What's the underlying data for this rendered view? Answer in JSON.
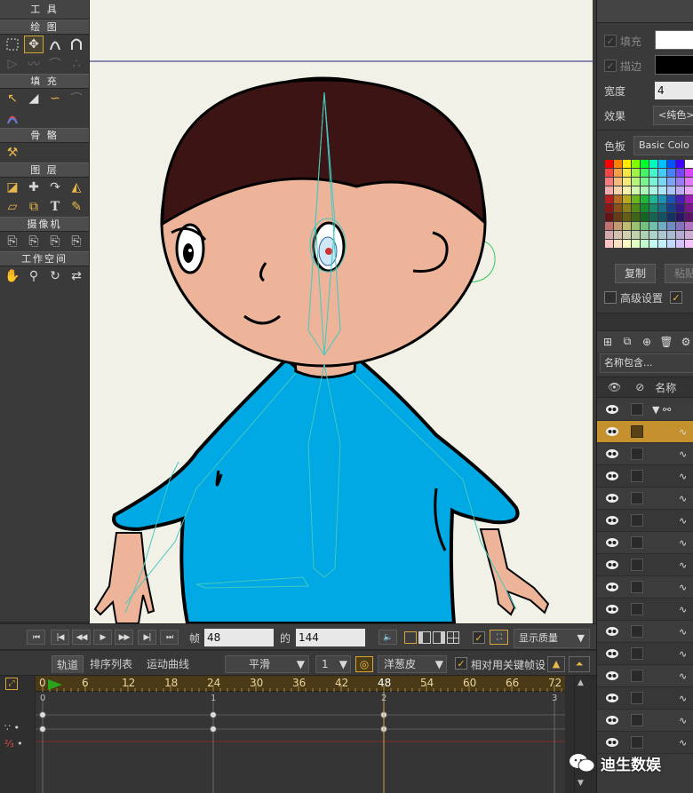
{
  "tools_panel": {
    "title": "工 具",
    "sections": {
      "draw": "绘 图",
      "fill": "填 充",
      "bone": "骨 骼",
      "layer": "图 层",
      "camera": "摄像机",
      "workspace": "工作空间"
    }
  },
  "style_panel": {
    "fill_label": "填充",
    "stroke_label": "描边",
    "fill_color": "#ffffff",
    "stroke_color": "#000000",
    "width_label": "宽度",
    "width_value": "4",
    "effect_label": "效果",
    "effect_value": "<纯色>",
    "swatches_label": "色板",
    "swatches_value": "Basic Colo",
    "copy_button": "复制",
    "paste_button": "粘贴",
    "advanced_label": "高级设置"
  },
  "layers_panel": {
    "search_value": "名称包含...",
    "name_header": "名称",
    "rows": [
      {
        "selected": false,
        "group": true
      },
      {
        "selected": true
      },
      {
        "selected": false
      },
      {
        "selected": false
      },
      {
        "selected": false
      },
      {
        "selected": false
      },
      {
        "selected": false
      },
      {
        "selected": false
      },
      {
        "selected": false
      },
      {
        "selected": false
      },
      {
        "selected": false
      },
      {
        "selected": false
      },
      {
        "selected": false
      },
      {
        "selected": false
      },
      {
        "selected": false
      },
      {
        "selected": false
      }
    ]
  },
  "playback": {
    "frame_label": "帧",
    "frame_value": "48",
    "of_label": "的",
    "total_value": "144",
    "quality_value": "显示质量"
  },
  "timeline": {
    "tab_track": "轨道",
    "tab_sequence": "排序列表",
    "tab_motion": "运动曲线",
    "interp_value": "平滑",
    "interval_value": "1",
    "onion_label": "洋葱皮",
    "relative_keys_label": "相对用关键帧设",
    "ruler_ticks": [
      "0",
      "6",
      "12",
      "18",
      "24",
      "30",
      "36",
      "42",
      "48",
      "54",
      "60",
      "66",
      "72"
    ],
    "track_numbers": [
      "0",
      "1",
      "2",
      "3"
    ]
  },
  "watermark": "迪生数娱",
  "colors": {
    "accent": "#c4912e",
    "hair": "#3d1414",
    "skin": "#eeb49a",
    "shirt": "#00a9e4",
    "bone": "#43c8c0",
    "canvas_bg": "#f2f1e7"
  }
}
